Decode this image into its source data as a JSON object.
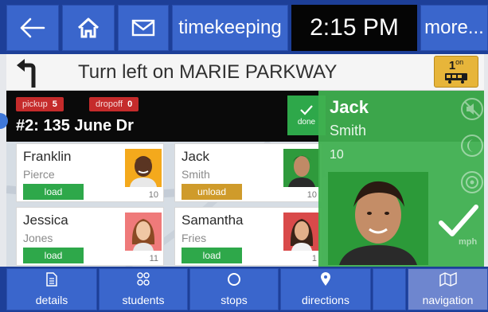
{
  "topbar": {
    "timekeeping_label": "timekeeping",
    "clock": "2:15 PM",
    "more_label": "more..."
  },
  "direction": {
    "instruction": "Turn left on MARIE PARKWAY",
    "bus_count": "1",
    "bus_count_suffix": "on"
  },
  "stop": {
    "pickup_label": "pickup",
    "pickup_count": "5",
    "dropoff_label": "dropoff",
    "dropoff_count": "0",
    "title": "#2: 135 June Dr",
    "done_label": "done"
  },
  "students": [
    {
      "first": "Franklin",
      "last": "Pierce",
      "action": "load",
      "number": "10"
    },
    {
      "first": "Jack",
      "last": "Smith",
      "action": "unload",
      "number": "10"
    },
    {
      "first": "Jessica",
      "last": "Jones",
      "action": "load",
      "number": "11"
    },
    {
      "first": "Samantha",
      "last": "Fries",
      "action": "load",
      "number": "1"
    }
  ],
  "selected_student": {
    "first": "Jack",
    "last": "Smith",
    "number": "10",
    "speed_unit": "mph"
  },
  "bottom_nav": {
    "details": "details",
    "students": "students",
    "stops": "stops",
    "directions": "directions",
    "navigation": "navigation"
  },
  "colors": {
    "nav_bg": "#1d3f98",
    "button_bg": "#3a66cc",
    "load_green": "#2ea84a",
    "unload_gold": "#cf9b2b",
    "badge_red": "#c52b2b",
    "bus_badge": "#e7b53a"
  },
  "icons": {
    "back": "arrow-left-icon",
    "home": "home-icon",
    "mail": "mail-icon",
    "turn": "turn-left-icon",
    "bus": "bus-icon",
    "done": "check-icon",
    "details": "document-icon",
    "students": "students-icon",
    "stops": "circle-icon",
    "directions": "location-pin-icon",
    "navigation": "map-icon"
  }
}
